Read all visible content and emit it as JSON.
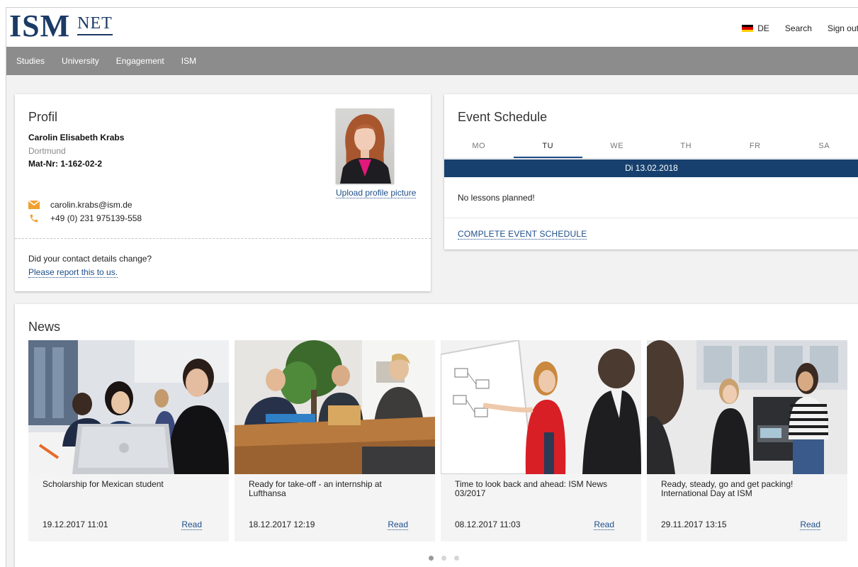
{
  "brand": {
    "name": "ISM",
    "sub": "NET",
    "color": "#1b3b66"
  },
  "header": {
    "language": "DE",
    "search": "Search",
    "signout": "Sign out"
  },
  "nav": {
    "items": [
      "Studies",
      "University",
      "Engagement",
      "ISM"
    ]
  },
  "profile": {
    "title": "Profil",
    "name": "Carolin Elisabeth Krabs",
    "city": "Dortmund",
    "mat": "Mat-Nr: 1-162-02-2",
    "email": "carolin.krabs@ism.de",
    "phone": "+49 (0) 231 975139-558",
    "upload": "Upload profile picture",
    "question": "Did your contact details change?",
    "report": "Please report this to us."
  },
  "schedule": {
    "title": "Event Schedule",
    "days": [
      "MO",
      "TU",
      "WE",
      "TH",
      "FR",
      "SA"
    ],
    "active_day": "TU",
    "date": "Di 13.02.2018",
    "empty": "No lessons planned!",
    "complete": "COMPLETE EVENT SCHEDULE"
  },
  "news": {
    "title": "News",
    "read_label": "Read",
    "items": [
      {
        "title": "Scholarship for Mexican student",
        "date": "19.12.2017 11:01"
      },
      {
        "title": "Ready for take-off - an internship at Lufthansa",
        "date": "18.12.2017 12:19"
      },
      {
        "title": "Time to look back and ahead: ISM News 03/2017",
        "date": "08.12.2017 11:03"
      },
      {
        "title": "Ready, steady, go and get packing! International Day at ISM",
        "date": "29.11.2017 13:15"
      }
    ],
    "pager": {
      "total": 3,
      "current": 1
    }
  },
  "colors": {
    "nav_bg": "#8c8c8c",
    "accent": "#1d4e89",
    "date_bar": "#17406e",
    "icon": "#f0a030"
  }
}
